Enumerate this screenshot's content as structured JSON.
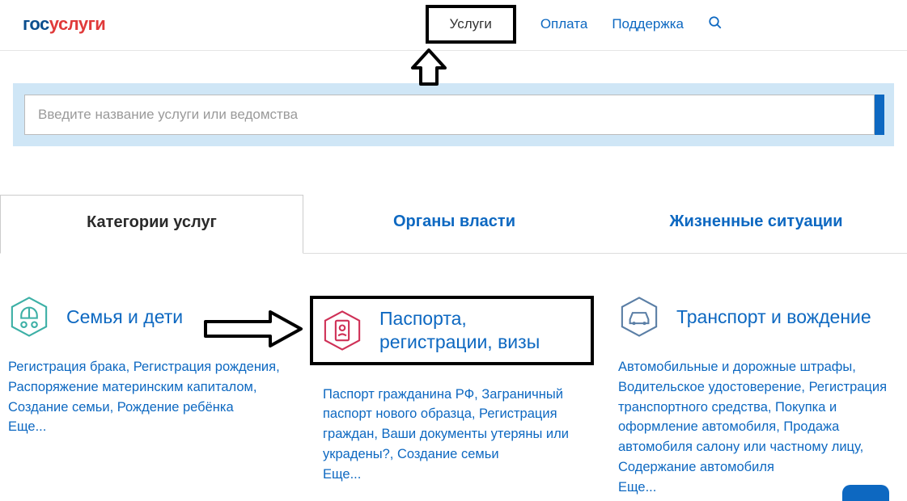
{
  "header": {
    "logo_part1": "гос",
    "logo_part2": "услуги",
    "nav": {
      "services": "Услуги",
      "payment": "Оплата",
      "support": "Поддержка"
    }
  },
  "search": {
    "placeholder": "Введите название услуги или ведомства"
  },
  "tabs": {
    "categories": "Категории услуг",
    "authorities": "Органы власти",
    "situations": "Жизненные ситуации"
  },
  "card_family": {
    "title": "Семья и дети",
    "links": "Регистрация брака, Регистрация рождения, Распоряжение материнским капиталом, Создание семьи, Рождение ребёнка",
    "more": "Еще..."
  },
  "card_passport": {
    "title": "Паспорта, регистрации, визы",
    "links": "Паспорт гражданина РФ, Заграничный паспорт нового образца, Регистрация граждан, Ваши документы утеряны или украдены?, Создание семьи",
    "more": "Еще..."
  },
  "card_transport": {
    "title": "Транспорт и вождение",
    "links": "Автомобильные и дорожные штрафы, Водительское удостоверение, Регистрация транспортного средства, Покупка и оформление автомобиля, Продажа автомобиля салону или частному лицу, Содержание автомобиля",
    "more": "Еще..."
  }
}
